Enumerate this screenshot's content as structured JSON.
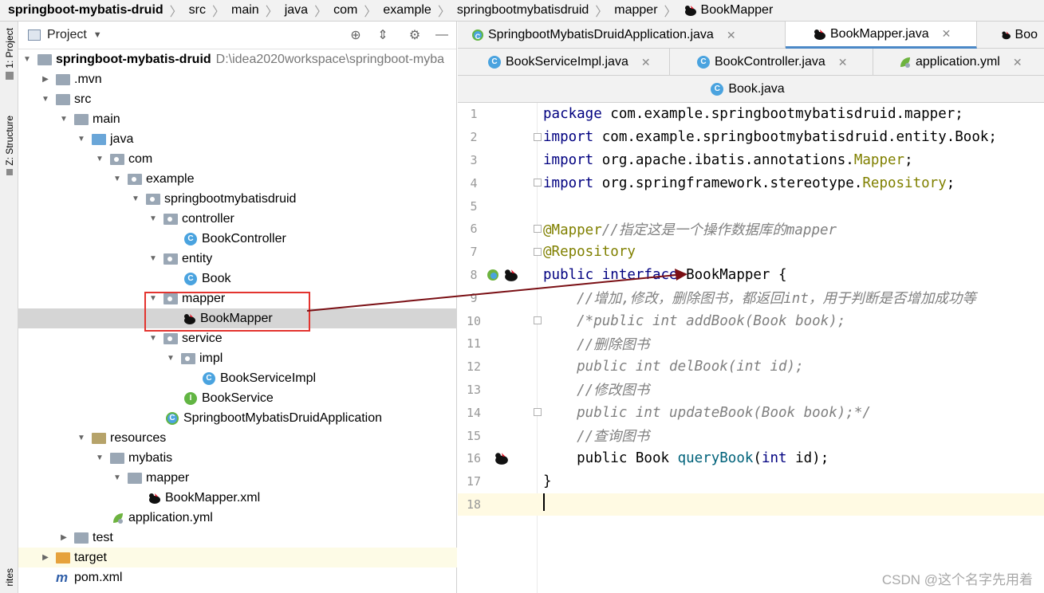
{
  "breadcrumb": [
    "springboot-mybatis-druid",
    "src",
    "main",
    "java",
    "com",
    "example",
    "springbootmybatisdruid",
    "mapper",
    "BookMapper"
  ],
  "stripe": {
    "project_label": "1: Project",
    "structure_label": "Z: Structure",
    "favorites_label": "rites"
  },
  "project_panel": {
    "title": "Project",
    "tools": [
      "globe-icon",
      "collapse-icon",
      "gear-icon",
      "minimize-icon"
    ]
  },
  "tree": {
    "root_name": "springboot-mybatis-druid",
    "root_path": "D:\\idea2020workspace\\springboot-myba",
    "mvn": ".mvn",
    "src": "src",
    "main": "main",
    "java": "java",
    "com": "com",
    "example": "example",
    "pkg": "springbootmybatisdruid",
    "controller": "controller",
    "book_controller": "BookController",
    "entity": "entity",
    "book": "Book",
    "mapper": "mapper",
    "book_mapper": "BookMapper",
    "service": "service",
    "impl": "impl",
    "book_service_impl": "BookServiceImpl",
    "book_service": "BookService",
    "app": "SpringbootMybatisDruidApplication",
    "resources": "resources",
    "mybatis": "mybatis",
    "res_mapper": "mapper",
    "mapper_xml": "BookMapper.xml",
    "app_yml": "application.yml",
    "test": "test",
    "target": "target",
    "pom": "pom.xml"
  },
  "tabs": {
    "row1": [
      {
        "label": "SpringbootMybatisDruidApplication.java",
        "icon": "spring-class-icon",
        "active": false
      },
      {
        "label": "BookMapper.java",
        "icon": "mybatis-bird-icon",
        "active": true
      },
      {
        "label": "Boo",
        "icon": "mybatis-bird-icon",
        "active": false
      }
    ],
    "row2": [
      {
        "label": "BookServiceImpl.java",
        "icon": "class-icon"
      },
      {
        "label": "BookController.java",
        "icon": "class-icon"
      },
      {
        "label": "application.yml",
        "icon": "yml-icon"
      }
    ],
    "row3": [
      {
        "label": "Book.java",
        "icon": "class-icon"
      }
    ]
  },
  "code": {
    "line_numbers": [
      "1",
      "2",
      "3",
      "4",
      "5",
      "6",
      "7",
      "8",
      "9",
      "10",
      "11",
      "12",
      "13",
      "14",
      "15",
      "16",
      "17",
      "18"
    ],
    "l1_kw": "package",
    "l1_rest": " com.example.springbootmybatisdruid.mapper;",
    "l2_kw": "import",
    "l2_rest": " com.example.springbootmybatisdruid.entity.Book;",
    "l3_kw": "import",
    "l3_rest": " org.apache.ibatis.annotations.",
    "l3_ann": "Mapper",
    "l3_end": ";",
    "l4_kw": "import",
    "l4_rest": " org.springframework.stereotype.",
    "l4_ann": "Repository",
    "l4_end": ";",
    "l6_ann": "@Mapper",
    "l6_cmt": "//指定这是一个操作数据库的mapper",
    "l7_ann": "@Repository",
    "l8_kw": "public interface",
    "l8_rest": " BookMapper {",
    "l9_cmt": "    //增加,修改，删除图书，都返回int，用于判断是否增加成功等",
    "l10_cmt": "    /*public int addBook(Book book);",
    "l11_cmt": "    //删除图书",
    "l12_cmt": "    public int delBook(int id);",
    "l13_cmt": "    //修改图书",
    "l14_cmt": "    public int updateBook(Book book);*/",
    "l15_cmt": "    //查询图书",
    "l16_a": "    public Book ",
    "l16_fn": "queryBook",
    "l16_b": "(",
    "l16_kw": "int",
    "l16_c": " id);",
    "l17": "}"
  },
  "watermark": "CSDN @这个名字先用着",
  "colors": {
    "highlight_box": "#e3342f",
    "pointer_arrow": "#7a0f14",
    "tab_active_underline": "#4a88c7"
  }
}
